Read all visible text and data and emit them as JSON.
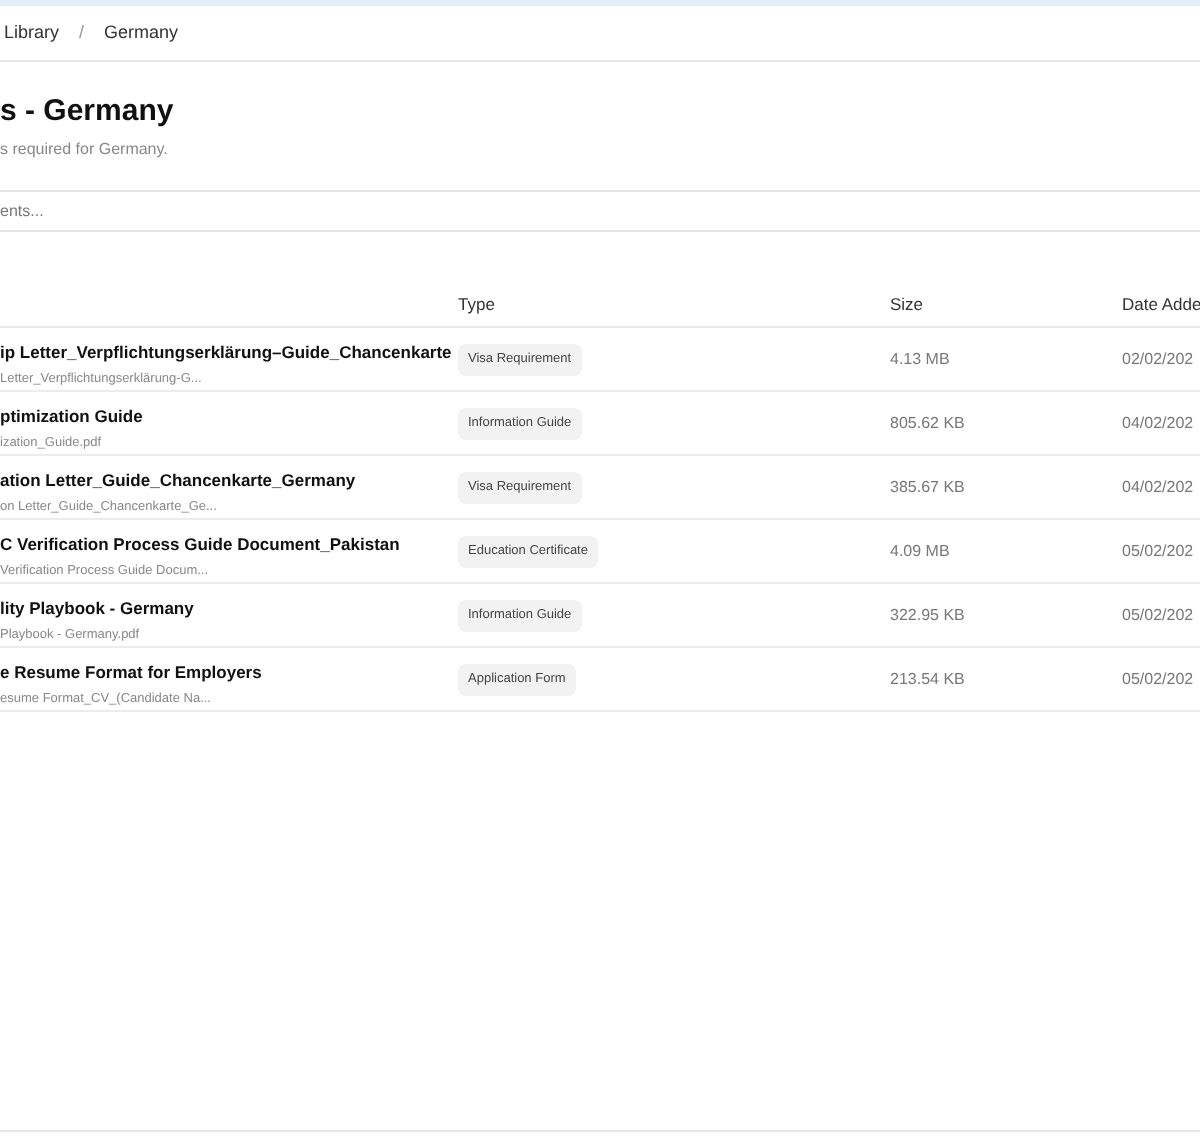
{
  "breadcrumb": [
    "Library",
    "/",
    "Germany"
  ],
  "page": {
    "title": "s - Germany",
    "subtitle": "s required for Germany."
  },
  "search": {
    "placeholder": "ents..."
  },
  "table": {
    "columns": [
      "Type",
      "Size",
      "Date Adde"
    ],
    "rows": [
      {
        "name": "ip Letter_Verpflichtungserklärung–Guide_Chancenkarte",
        "file": "Letter_Verpflichtungserklärung-G...",
        "type": "Visa Requirement",
        "size": "4.13 MB",
        "date": "02/02/202"
      },
      {
        "name": "ptimization Guide",
        "file": "ization_Guide.pdf",
        "type": "Information Guide",
        "size": "805.62 KB",
        "date": "04/02/202"
      },
      {
        "name": "ation Letter_Guide_Chancenkarte_Germany",
        "file": "on Letter_Guide_Chancenkarte_Ge...",
        "type": "Visa Requirement",
        "size": "385.67 KB",
        "date": "04/02/202"
      },
      {
        "name": "C Verification Process Guide Document_Pakistan",
        "file": "Verification Process Guide Docum...",
        "type": "Education Certificate",
        "size": "4.09 MB",
        "date": "05/02/202"
      },
      {
        "name": "lity Playbook - Germany",
        "file": "Playbook - Germany.pdf",
        "type": "Information Guide",
        "size": "322.95 KB",
        "date": "05/02/202"
      },
      {
        "name": "e Resume Format for Employers",
        "file": "esume Format_CV_(Candidate Na...",
        "type": "Application Form",
        "size": "213.54 KB",
        "date": "05/02/202"
      }
    ]
  }
}
